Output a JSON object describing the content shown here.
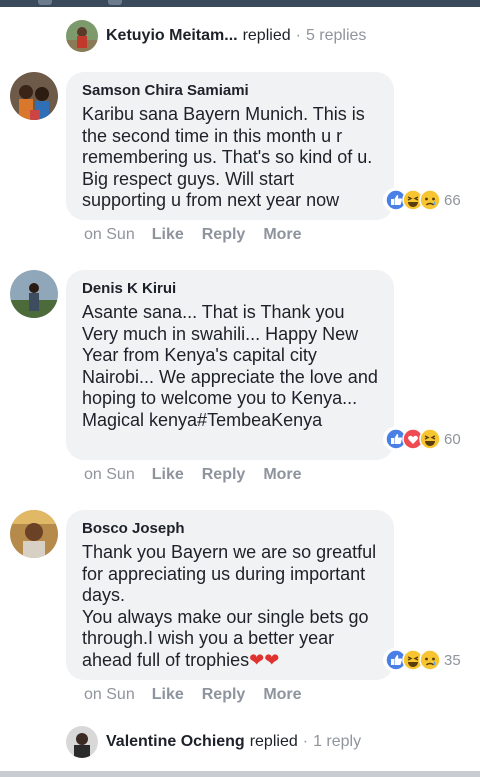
{
  "top_reply": {
    "name": "Ketuyio Meitam...",
    "verb": "replied",
    "count": "5 replies"
  },
  "comments": [
    {
      "author": "Samson Chira Samiami",
      "text": "Karibu sana Bayern Munich. This is the second time in this month u r remembering us. That's so kind of u. Big respect guys. Will start supporting u from next year now",
      "reactions": [
        "like",
        "haha",
        "sad"
      ],
      "reaction_count": "66",
      "time": "on Sun",
      "actions": [
        "Like",
        "Reply",
        "More"
      ]
    },
    {
      "author": "Denis K Kirui",
      "text": "Asante sana... That is Thank you Very much in swahili... Happy New Year from Kenya's capital city Nairobi... We appreciate the love and hoping to welcome you to Kenya... Magical kenya#TembeaKenya",
      "reactions": [
        "like",
        "love",
        "haha"
      ],
      "reaction_count": "60",
      "time": "on Sun",
      "actions": [
        "Like",
        "Reply",
        "More"
      ]
    },
    {
      "author": "Bosco Joseph",
      "text": "Thank you Bayern we are so greatful for appreciating us during important days.\nYou always make our single bets go through.I wish you a better year ahead full of trophies",
      "text_suffix": "❤❤",
      "reactions": [
        "like",
        "haha",
        "sad"
      ],
      "reaction_count": "35",
      "time": "on Sun",
      "actions": [
        "Like",
        "Reply",
        "More"
      ]
    }
  ],
  "bottom_reply": {
    "name": "Valentine Ochieng",
    "verb": "replied",
    "count": "1 reply"
  },
  "colors": {
    "like": "#4a7fe6",
    "love": "#ef4b52",
    "emoji": "#f7c531",
    "muted": "#90949c",
    "bubble": "#f1f2f4"
  }
}
